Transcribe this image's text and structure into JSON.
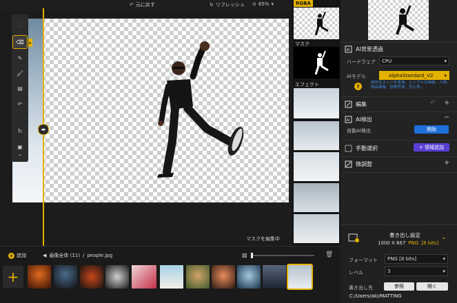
{
  "topbar": {
    "undo_label": "元に戻す",
    "refresh_label": "リフレッシュ",
    "zoom": "65%"
  },
  "canvas": {
    "mask_edit_label": "マスクを編集中"
  },
  "strip": {
    "rgba_label": "RGBA",
    "mask_label": "マスク",
    "effect_label": "エフェクト"
  },
  "panel": {
    "ai_bg": {
      "title": "AI背景透過",
      "hardware_label": "ハードウェア",
      "hardware_value": "CPU",
      "model_label": "AIモデル",
      "model_value": "AlphaStandard_V2",
      "description": "自然なエッジを実現。シンプルな画像、人物、商品画像、証明写真、空と夜。"
    },
    "edit": {
      "title": "編集"
    },
    "ai_detect": {
      "title": "AI検出",
      "auto_label": "自動AI検出",
      "start_button": "開始"
    },
    "manual": {
      "title": "手動選択",
      "add_area_button": "+ 領域追加"
    },
    "fine_tune": {
      "title": "微調整"
    },
    "export": {
      "title": "書き出し設定",
      "size": "1000 X 667",
      "format_short": "PNG",
      "bits": "[8 bits]",
      "format_label": "フォーマット",
      "format_value": "PNG   [8 bits]",
      "level_label": "レベル",
      "level_value": "3",
      "dest_label": "書き出し先",
      "browse_button": "参照",
      "open_button": "開く",
      "path": "C:/Users/aki/MATTING"
    }
  },
  "bottom": {
    "add_label": "追加",
    "breadcrumb_all": "画像全体 (11)",
    "separator": "/",
    "filename": "people.jpg"
  },
  "colors": {
    "accent": "#e4b100",
    "primary_button": "#1e6fd9",
    "panel_bg": "#232323"
  }
}
